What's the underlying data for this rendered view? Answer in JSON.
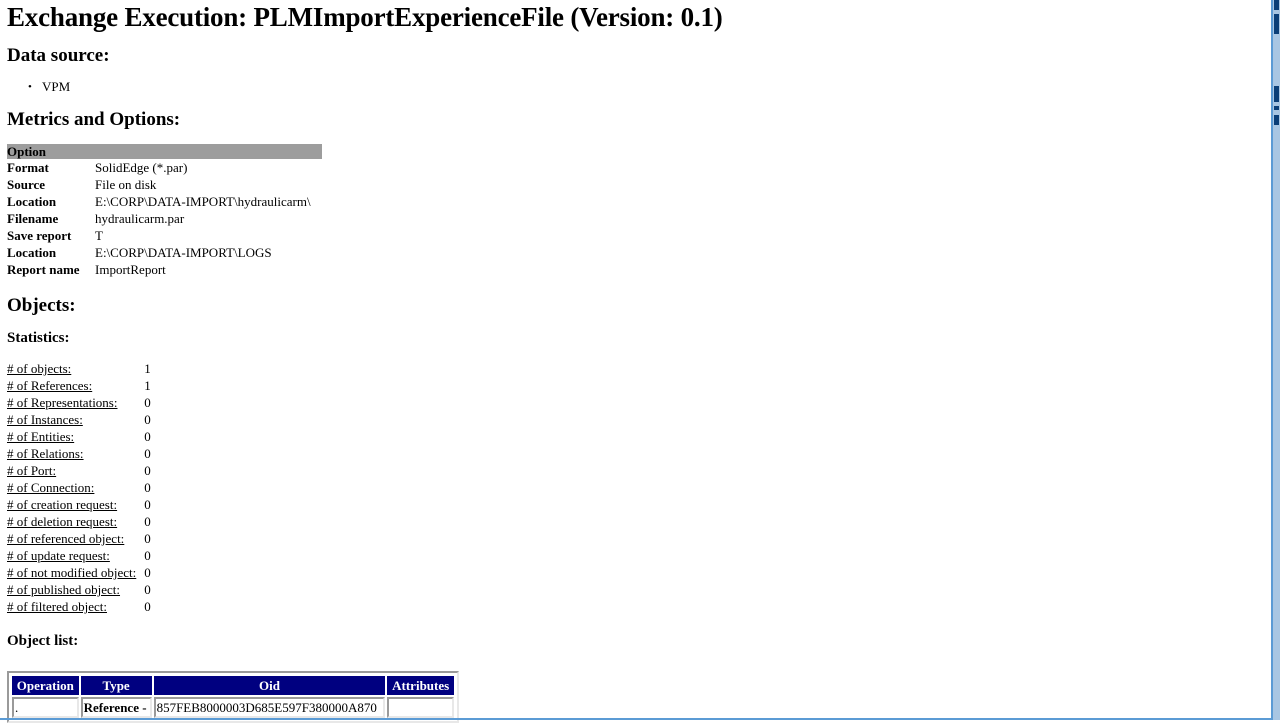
{
  "document": {
    "title": "Exchange Execution: PLMImportExperienceFile (Version: 0.1)"
  },
  "data_source": {
    "heading": "Data source:",
    "items": [
      "VPM"
    ]
  },
  "metrics_and_options": {
    "heading": "Metrics and Options:",
    "table_header": "Option",
    "rows": [
      {
        "key": "Format",
        "value": "SolidEdge (*.par)"
      },
      {
        "key": "Source",
        "value": "File on disk"
      },
      {
        "key": "Location",
        "value": "E:\\CORP\\DATA-IMPORT\\hydraulicarm\\"
      },
      {
        "key": "Filename",
        "value": "hydraulicarm.par"
      },
      {
        "key": "Save report",
        "value": "T"
      },
      {
        "key": "Location",
        "value": "E:\\CORP\\DATA-IMPORT\\LOGS"
      },
      {
        "key": "Report name",
        "value": "ImportReport"
      }
    ]
  },
  "objects": {
    "heading": "Objects:"
  },
  "statistics": {
    "heading": "Statistics:",
    "rows": [
      {
        "label": "# of objects:",
        "value": "1"
      },
      {
        "label": "# of References:",
        "value": "1"
      },
      {
        "label": "# of Representations:",
        "value": "0"
      },
      {
        "label": "# of Instances:",
        "value": "0"
      },
      {
        "label": "# of Entities:",
        "value": "0"
      },
      {
        "label": "# of Relations:",
        "value": "0"
      },
      {
        "label": "# of Port:",
        "value": "0"
      },
      {
        "label": "# of Connection:",
        "value": "0"
      },
      {
        "label": "# of creation request:",
        "value": "0"
      },
      {
        "label": "# of deletion request:",
        "value": "0"
      },
      {
        "label": "# of referenced object:",
        "value": "0"
      },
      {
        "label": "# of update request:",
        "value": "0"
      },
      {
        "label": "# of not modified object:",
        "value": "0"
      },
      {
        "label": "# of published object:",
        "value": "0"
      },
      {
        "label": "# of filtered object:",
        "value": "0"
      }
    ]
  },
  "object_list": {
    "heading": "Object list:",
    "columns": [
      "Operation",
      "Type",
      "Oid",
      "Attributes"
    ],
    "rows": [
      {
        "operation": ".",
        "type": "Reference -",
        "oid": "857FEB8000003D685E597F380000A870",
        "attributes": ""
      }
    ]
  },
  "colors": {
    "table_header_bg": "#000080",
    "table_header_fg": "#ffffff",
    "option_header_bg": "#9d9d9d",
    "frame_accent": "#5b9bd5",
    "scroll_thumb": "#0b3f78"
  }
}
